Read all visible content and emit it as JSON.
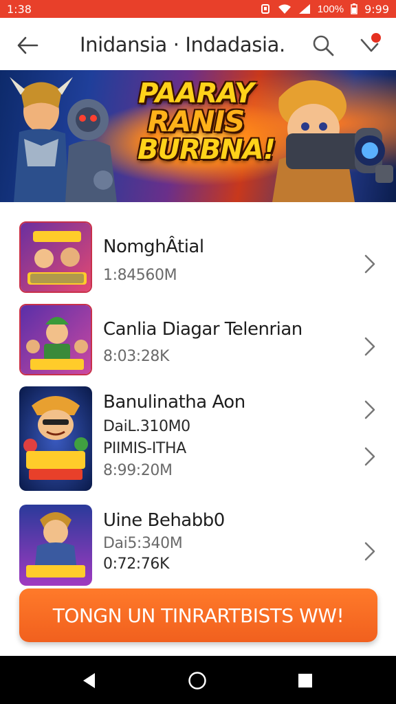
{
  "status_bar": {
    "time": "1:38",
    "battery": "100%",
    "clock": "9:99"
  },
  "app_bar": {
    "title": "Inidansia · Indadasia."
  },
  "banner": {
    "lines": [
      "PAARAY",
      "RANIS",
      "BURBNA!"
    ]
  },
  "games": [
    {
      "name": "NomghÂtial",
      "meta": [
        "1:84560M"
      ]
    },
    {
      "name": "Canlia Diagar Telenrian",
      "meta": [
        "8:03:28K"
      ]
    },
    {
      "name": "Banulinatha Aon",
      "meta": [
        "DaiL.310M0",
        "PIIMIS-ITHA",
        "8:99:20M"
      ]
    },
    {
      "name": "Uine Behabb0",
      "meta": [
        "Dai5:340M",
        "0:72:76K"
      ]
    }
  ],
  "cta": {
    "label": "TONGN UN TINRARTBISTS WW!"
  },
  "colors": {
    "accent": "#e8402a",
    "cta": "#f26a22",
    "notification": "#e53020"
  }
}
